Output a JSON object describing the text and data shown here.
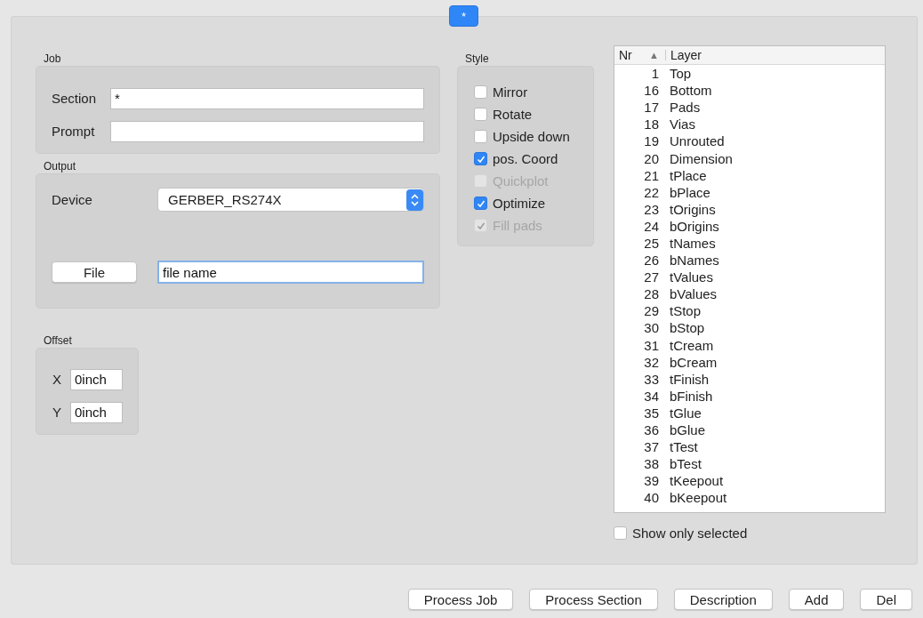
{
  "tabs": [
    {
      "label": "*",
      "selected": true
    }
  ],
  "job": {
    "title": "Job",
    "fields": [
      {
        "label": "Section",
        "value": "*"
      },
      {
        "label": "Prompt"
      }
    ]
  },
  "output": {
    "title": "Output",
    "device_label": "Device",
    "device": "GERBER_RS274X",
    "file_button": "File",
    "file_name": "file name"
  },
  "offset": {
    "title": "Offset",
    "fields": [
      {
        "label": "X",
        "value": "0inch"
      },
      {
        "label": "Y",
        "value": "0inch"
      }
    ]
  },
  "style": {
    "title": "Style",
    "options": [
      {
        "label": "Mirror",
        "checked": false,
        "disabled": false
      },
      {
        "label": "Rotate",
        "checked": false,
        "disabled": false
      },
      {
        "label": "Upside down",
        "checked": false,
        "disabled": false
      },
      {
        "label": "pos. Coord",
        "checked": true,
        "disabled": false
      },
      {
        "label": "Quickplot",
        "checked": false,
        "disabled": true
      },
      {
        "label": "Optimize",
        "checked": true,
        "disabled": false
      },
      {
        "label": "Fill pads",
        "checked": true,
        "disabled": true
      }
    ]
  },
  "layers": {
    "columns": [
      "Nr",
      "Layer"
    ],
    "sort_indicator": "▲",
    "rows": [
      [
        "1",
        "Top"
      ],
      [
        "16",
        "Bottom"
      ],
      [
        "17",
        "Pads"
      ],
      [
        "18",
        "Vias"
      ],
      [
        "19",
        "Unrouted"
      ],
      [
        "20",
        "Dimension"
      ],
      [
        "21",
        "tPlace"
      ],
      [
        "22",
        "bPlace"
      ],
      [
        "23",
        "tOrigins"
      ],
      [
        "24",
        "bOrigins"
      ],
      [
        "25",
        "tNames"
      ],
      [
        "26",
        "bNames"
      ],
      [
        "27",
        "tValues"
      ],
      [
        "28",
        "bValues"
      ],
      [
        "29",
        "tStop"
      ],
      [
        "30",
        "bStop"
      ],
      [
        "31",
        "tCream"
      ],
      [
        "32",
        "bCream"
      ],
      [
        "33",
        "tFinish"
      ],
      [
        "34",
        "bFinish"
      ],
      [
        "35",
        "tGlue"
      ],
      [
        "36",
        "bGlue"
      ],
      [
        "37",
        "tTest"
      ],
      [
        "38",
        "bTest"
      ],
      [
        "39",
        "tKeepout"
      ],
      [
        "40",
        "bKeepout"
      ]
    ]
  },
  "show_only_selected": {
    "label": "Show only selected",
    "checked": false
  },
  "buttons": [
    "Process Job",
    "Process Section",
    "Description",
    "Add",
    "Del"
  ]
}
